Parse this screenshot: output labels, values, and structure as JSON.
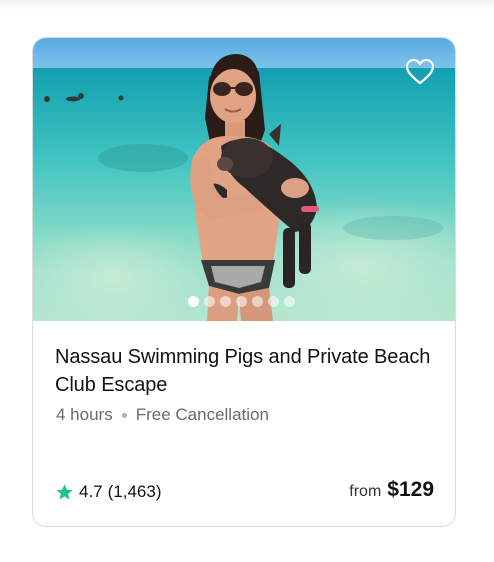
{
  "card": {
    "title": "Nassau Swimming Pigs and Private Beach Club Escape",
    "duration": "4 hours",
    "cancellation": "Free Cancellation",
    "rating": "4.7",
    "review_count": "(1,463)",
    "price_prefix": "from",
    "price": "$129",
    "wishlist_icon": "heart-outline-icon",
    "rating_icon": "star-icon",
    "image_dots": {
      "total": 7,
      "active": 1
    }
  },
  "colors": {
    "star": "#1ec28b",
    "text_primary": "#111111",
    "text_secondary": "#6b6b6b",
    "border": "#dcdcdc"
  }
}
